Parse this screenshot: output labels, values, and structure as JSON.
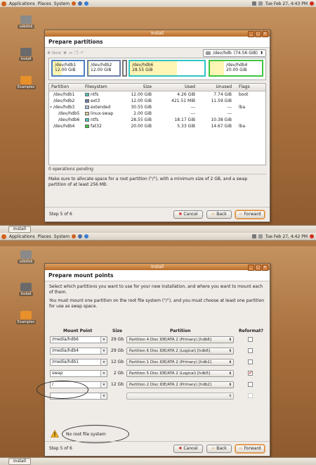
{
  "top_panel_1": {
    "menu": [
      "Applications",
      "Places",
      "System"
    ],
    "clock": "Tue Feb 27,  4:43 PM"
  },
  "desktop_1": {
    "icons": [
      "usbdisk",
      "Install",
      "Examples"
    ]
  },
  "partition_window": {
    "title": "Install",
    "header": "Prepare partitions",
    "toolbar": {
      "new": "New",
      "device": "/dev/hdb",
      "device_size": "(74.56 GiB)"
    },
    "segments": [
      {
        "name": "/dev/hdb1",
        "size": "12.00 GiB",
        "color": "#4c7ec2"
      },
      {
        "name": "/dev/hdb2",
        "size": "12.00 GiB",
        "color": "#6b7fa6"
      },
      {
        "name": "/dev/hdb6",
        "size": "28.55 GiB",
        "color": "#2fc3c3"
      },
      {
        "name": "/dev/hdb4",
        "size": "20.00 GiB",
        "color": "#3ec63e"
      }
    ],
    "columns": [
      "Partition",
      "Filesystem",
      "Size",
      "Used",
      "Unused",
      "Flags"
    ],
    "rows": [
      {
        "partition": "/dev/hdb1",
        "fs": "ntfs",
        "fs_color": "#4bc7b0",
        "size": "12.00 GiB",
        "used": "4.26 GiB",
        "unused": "7.74 GiB",
        "flags": "boot"
      },
      {
        "partition": "/dev/hdb2",
        "fs": "ext3",
        "fs_color": "#6b7fa6",
        "size": "12.00 GiB",
        "used": "421.51 MiB",
        "unused": "11.59 GiB",
        "flags": ""
      },
      {
        "partition": "/dev/hdb3",
        "fs": "extended",
        "fs_color": "#a8c6e4",
        "size": "30.55 GiB",
        "used": "---",
        "unused": "---",
        "flags": "lba"
      },
      {
        "partition": "/dev/hdb5",
        "fs": "linux-swap",
        "fs_color": "#d3ce98",
        "size": "2.00 GiB",
        "used": "---",
        "unused": "---",
        "flags": ""
      },
      {
        "partition": "/dev/hdb6",
        "fs": "ntfs",
        "fs_color": "#4bc7b0",
        "size": "28.55 GiB",
        "used": "18.17 GiB",
        "unused": "10.38 GiB",
        "flags": ""
      },
      {
        "partition": "/dev/hdb4",
        "fs": "fat32",
        "fs_color": "#3ec63e",
        "size": "20.00 GiB",
        "used": "5.33 GiB",
        "unused": "14.67 GiB",
        "flags": "lba"
      }
    ],
    "pending": "0 operations pending",
    "note": "Make sure to allocate space for a root partition (\"/\"), with a minimum size of 2 GB, and a swap partition of at least 256 MB.",
    "step": "Step 5 of 6",
    "buttons": {
      "cancel": "Cancel",
      "back": "Back",
      "forward": "Forward"
    }
  },
  "bottom_panel_1": {
    "task": "Install"
  },
  "top_panel_2": {
    "menu": [
      "Applications",
      "Places",
      "System"
    ],
    "clock": "Tue Feb 27,  4:42 PM"
  },
  "desktop_2": {
    "icons": [
      "usbdisk",
      "Install",
      "Examples"
    ]
  },
  "mount_window": {
    "title": "Install",
    "header": "Prepare mount points",
    "intro1": "Select which partitions you want to use for your new installation, and where you want to mount each of them.",
    "intro2": "You must mount one partition on the root file system (\"/\"), and you must choose at least one partition for use as swap space.",
    "columns": [
      "Mount Point",
      "Size",
      "Partition",
      "Reformat?"
    ],
    "rows": [
      {
        "mount": "/media/hdb6",
        "size": "29 Gb",
        "partition": "Partition 4 Disc IDE/ATA 2 (Primary) [hdb6]",
        "reformat": false
      },
      {
        "mount": "/media/hdb4",
        "size": "29 Gb",
        "partition": "Partition 6 Disc IDE/ATA 2 (Logical) [hdb6]",
        "reformat": false
      },
      {
        "mount": "/media/hdb1",
        "size": "12 Gb",
        "partition": "Partition 1 Disc IDE/ATA 2 (Primary) [hdb1]",
        "reformat": false
      },
      {
        "mount": "swap",
        "size": "2 Gb",
        "partition": "Partition 5 Disc IDE/ATA 2 (Logical) [hdb5]",
        "reformat": true
      },
      {
        "mount": "/",
        "size": "12 Gb",
        "partition": "Partition 2 Disc IDE/ATA 2 (Primary) [hdb2]",
        "reformat": false
      },
      {
        "mount": "",
        "size": "",
        "partition": "",
        "reformat": false
      }
    ],
    "warning": "No root file system",
    "step": "Step 5 of 6",
    "buttons": {
      "cancel": "Cancel",
      "back": "Back",
      "forward": "Forward"
    }
  },
  "bottom_panel_2": {
    "task": "Install"
  }
}
